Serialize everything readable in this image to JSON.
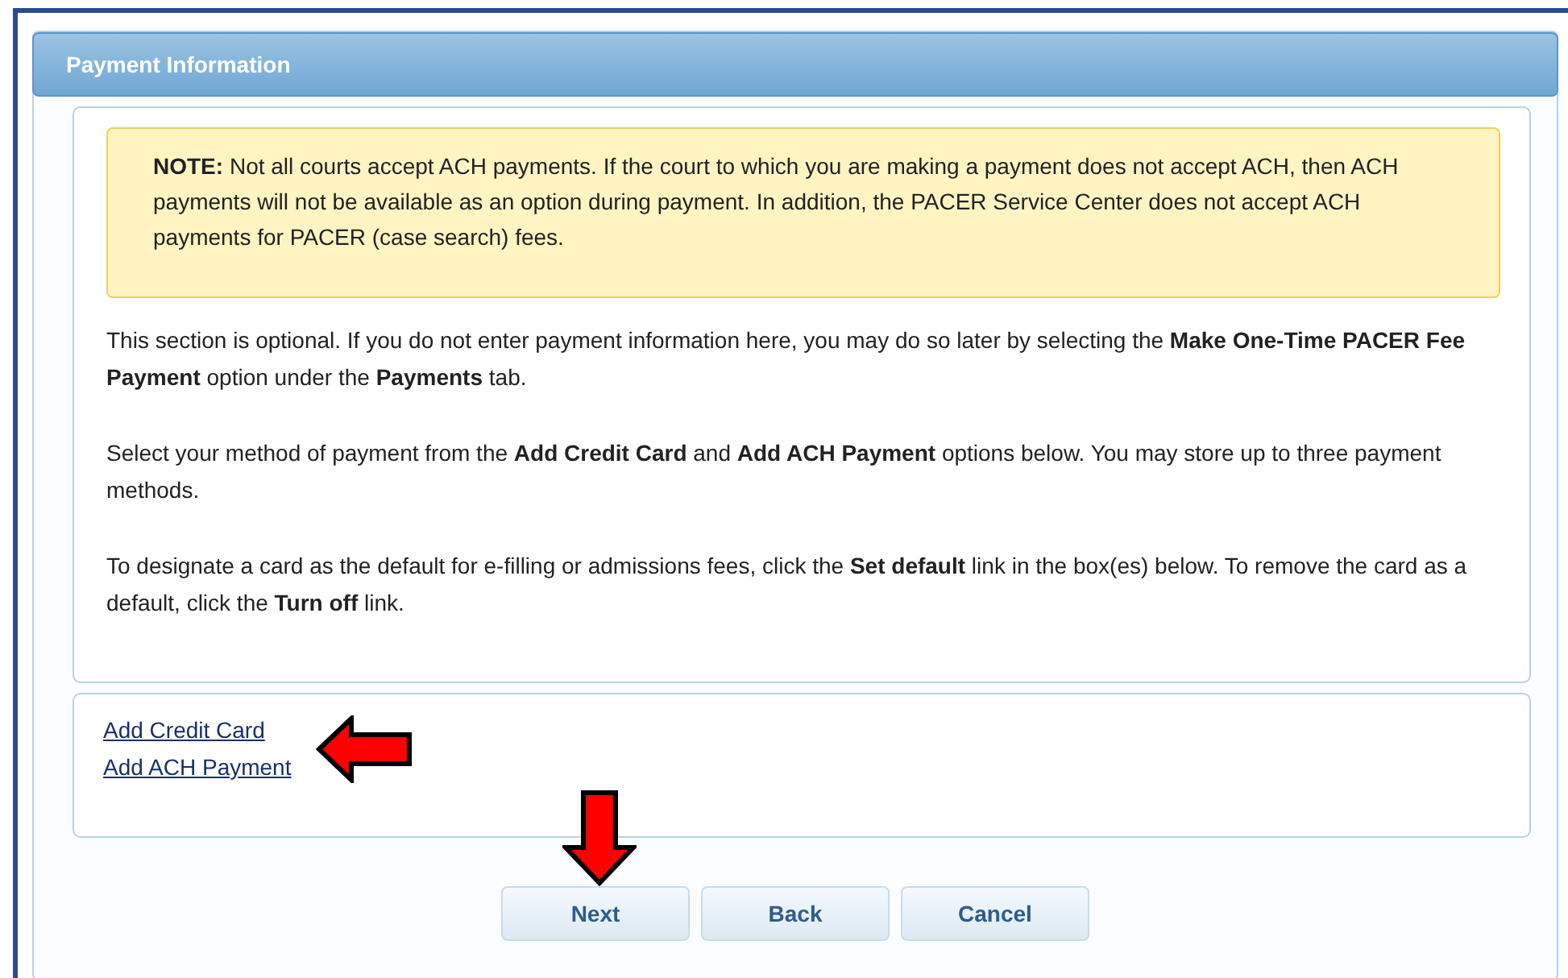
{
  "panel": {
    "title": "Payment Information"
  },
  "note": "**NOTE:** Not all courts accept ACH payments. If the court to which you are making a payment does not accept ACH, then ACH payments will not be available as an option during payment. In addition, the PACER Service Center does not accept ACH payments for PACER (case search) fees.",
  "paragraphs": [
    "This section is optional. If you do not enter payment information here, you may do so later by selecting the **Make One-Time PACER Fee Payment** option under the **Payments** tab.",
    "Select your method of payment from the **Add Credit Card** and **Add ACH Payment** options below. You may store up to three payment methods.",
    "To designate a card as the default for e-filling or admissions fees, click the **Set default** link in the box(es) below. To remove the card as a default, click the **Turn off** link."
  ],
  "links": [
    "Add Credit Card",
    "Add ACH Payment"
  ],
  "buttons": [
    "Next",
    "Back",
    "Cancel"
  ]
}
